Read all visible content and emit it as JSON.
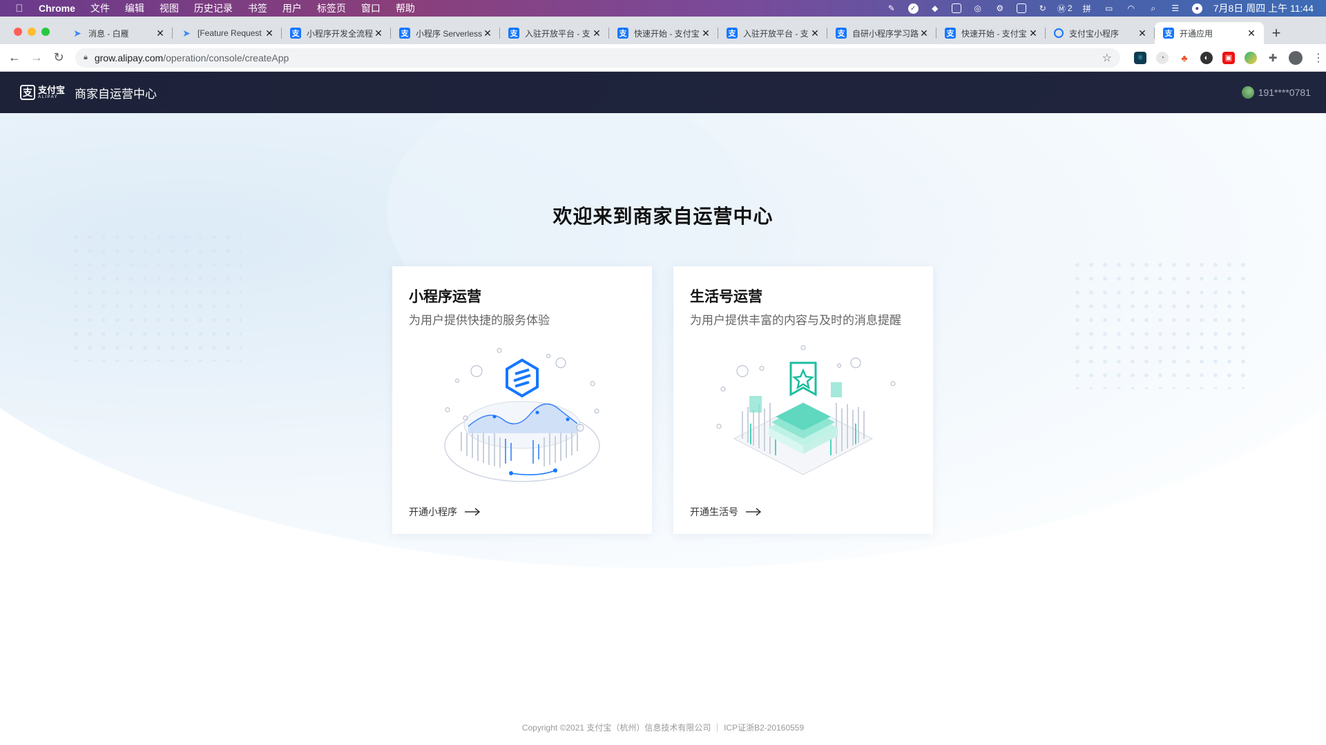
{
  "menubar": {
    "app_name": "Chrome",
    "items": [
      "文件",
      "编辑",
      "视图",
      "历史记录",
      "书签",
      "用户",
      "标签页",
      "窗口",
      "帮助"
    ],
    "status_badge": "2",
    "clock": "7月8日 周四 上午 11:44"
  },
  "tabs": [
    {
      "title": "消息 - 白雁",
      "icon": "bird-icon"
    },
    {
      "title": "[Feature Request",
      "icon": "bird-icon"
    },
    {
      "title": "小程序开发全流程",
      "icon": "alipay-icon"
    },
    {
      "title": "小程序 Serverless",
      "icon": "alipay-icon"
    },
    {
      "title": "入驻开放平台 - 支",
      "icon": "alipay-icon"
    },
    {
      "title": "快速开始 - 支付宝",
      "icon": "alipay-icon"
    },
    {
      "title": "入驻开放平台 - 支",
      "icon": "alipay-icon"
    },
    {
      "title": "自研小程序学习路",
      "icon": "alipay-icon"
    },
    {
      "title": "快速开始 - 支付宝",
      "icon": "alipay-icon"
    },
    {
      "title": "支付宝小程序",
      "icon": "miniapp-icon"
    },
    {
      "title": "开通应用",
      "icon": "alipay-icon",
      "active": true
    }
  ],
  "address_bar": {
    "host": "grow.alipay.com",
    "path": "/operation/console/createApp"
  },
  "header": {
    "logo_cn": "支付宝",
    "logo_en": "ALIPAY",
    "site_name": "商家自运营中心",
    "user": "191****0781"
  },
  "main": {
    "welcome": "欢迎来到商家自运营中心",
    "cards": [
      {
        "title": "小程序运营",
        "desc": "为用户提供快捷的服务体验",
        "action": "开通小程序"
      },
      {
        "title": "生活号运营",
        "desc": "为用户提供丰富的内容与及时的消息提醒",
        "action": "开通生活号"
      }
    ]
  },
  "footer": {
    "copyright": "Copyright ©2021 支付宝（杭州）信息技术有限公司 ｜ ICP证浙B2-20160559"
  },
  "colors": {
    "header_bg": "#1d2239",
    "accent_blue": "#1677ff",
    "accent_teal": "#2cc3a8"
  }
}
